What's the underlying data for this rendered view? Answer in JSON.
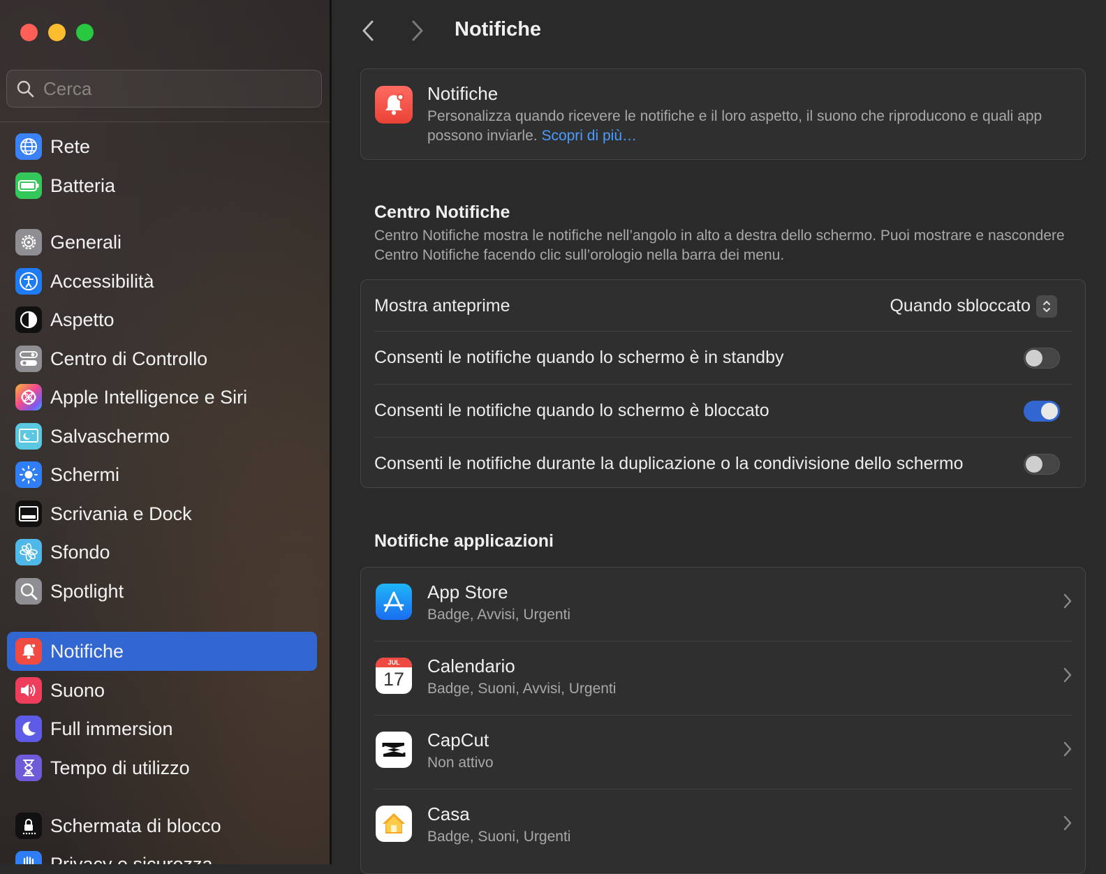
{
  "window": {
    "title": "Notifiche"
  },
  "sidebar": {
    "search_placeholder": "Cerca",
    "items": [
      {
        "label": "Rete",
        "icon": "globe-icon",
        "color": "#3b82f6"
      },
      {
        "label": "Batteria",
        "icon": "battery-icon",
        "color": "#34c759"
      },
      {
        "label": "Generali",
        "icon": "gear-icon",
        "color": "#8e8e93"
      },
      {
        "label": "Accessibilità",
        "icon": "accessibility-icon",
        "color": "#1e7bf2"
      },
      {
        "label": "Aspetto",
        "icon": "appearance-icon",
        "color": "#111111"
      },
      {
        "label": "Centro di Controllo",
        "icon": "control-center-icon",
        "color": "#8e8e93"
      },
      {
        "label": "Apple Intelligence e Siri",
        "icon": "siri-icon",
        "color": "#e86ab4"
      },
      {
        "label": "Salvaschermo",
        "icon": "screensaver-icon",
        "color": "#5ac8e0"
      },
      {
        "label": "Schermi",
        "icon": "brightness-icon",
        "color": "#2f7ef5"
      },
      {
        "label": "Scrivania e Dock",
        "icon": "dock-icon",
        "color": "#111111"
      },
      {
        "label": "Sfondo",
        "icon": "wallpaper-icon",
        "color": "#4fb8e8"
      },
      {
        "label": "Spotlight",
        "icon": "spotlight-icon",
        "color": "#8e8e93"
      },
      {
        "label": "Notifiche",
        "icon": "bell-icon",
        "color": "#ef4b42",
        "selected": true
      },
      {
        "label": "Suono",
        "icon": "speaker-icon",
        "color": "#ef3e5c"
      },
      {
        "label": "Full immersion",
        "icon": "moon-icon",
        "color": "#5e5ce6"
      },
      {
        "label": "Tempo di utilizzo",
        "icon": "hourglass-icon",
        "color": "#6e5bd8"
      },
      {
        "label": "Schermata di blocco",
        "icon": "lock-icon",
        "color": "#111111"
      },
      {
        "label": "Privacy e sicurezza",
        "icon": "hand-icon",
        "color": "#2f7ef5"
      }
    ]
  },
  "header": {
    "title": "Notifiche"
  },
  "intro": {
    "title": "Notifiche",
    "description": "Personalizza quando ricevere le notifiche e il loro aspetto, il suono che riproducono e quali app possono inviarle.",
    "link": "Scopri di più…"
  },
  "center": {
    "title": "Centro Notifiche",
    "description": "Centro Notifiche mostra le notifiche nell’angolo in alto a destra dello schermo. Puoi mostrare e nascondere Centro Notifiche facendo clic sull’orologio nella barra dei menu.",
    "preview_label": "Mostra anteprime",
    "preview_value": "Quando sbloccato",
    "toggles": [
      {
        "label": "Consenti le notifiche quando lo schermo è in standby",
        "on": false
      },
      {
        "label": "Consenti le notifiche quando lo schermo è bloccato",
        "on": true
      },
      {
        "label": "Consenti le notifiche durante la duplicazione o la condivisione dello schermo",
        "on": false
      }
    ]
  },
  "apps": {
    "title": "Notifiche applicazioni",
    "calendar_month": "JUL",
    "calendar_day": "17",
    "items": [
      {
        "name": "App Store",
        "detail": "Badge, Avvisi, Urgenti",
        "icon": "app-store-icon"
      },
      {
        "name": "Calendario",
        "detail": "Badge, Suoni, Avvisi, Urgenti",
        "icon": "calendar-icon"
      },
      {
        "name": "CapCut",
        "detail": "Non attivo",
        "icon": "capcut-icon"
      },
      {
        "name": "Casa",
        "detail": "Badge, Suoni, Urgenti",
        "icon": "home-icon"
      }
    ]
  },
  "colors": {
    "accent": "#3267d1",
    "link": "#4a9cff",
    "close": "#fe5f57",
    "minimize": "#febc2e",
    "maximize": "#28c840"
  }
}
